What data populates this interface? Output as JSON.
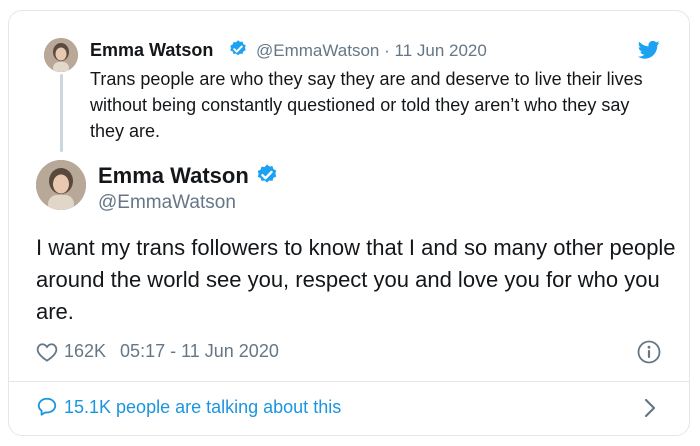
{
  "quoted_tweet": {
    "display_name": "Emma Watson",
    "handle": "@EmmaWatson",
    "separator": "·",
    "date": "11 Jun 2020",
    "text": "Trans people are who they say they are and deserve to live their lives without being constantly questioned or told they aren’t who they say they are."
  },
  "main_tweet": {
    "display_name": "Emma Watson",
    "handle": "@EmmaWatson",
    "text": "I want my trans followers to know that I and so many other people around the world see you, respect you and love you for who you are.",
    "likes": "162K",
    "timestamp": "05:17 - 11 Jun 2020"
  },
  "footer": {
    "talking_text": "15.1K people are talking about this"
  },
  "colors": {
    "verified": "#1da1f2",
    "link": "#1b95e0",
    "muted": "#657786"
  },
  "icons": [
    "verified-badge-icon",
    "twitter-bird-icon",
    "heart-icon",
    "info-icon",
    "speech-bubble-icon",
    "chevron-right-icon"
  ]
}
